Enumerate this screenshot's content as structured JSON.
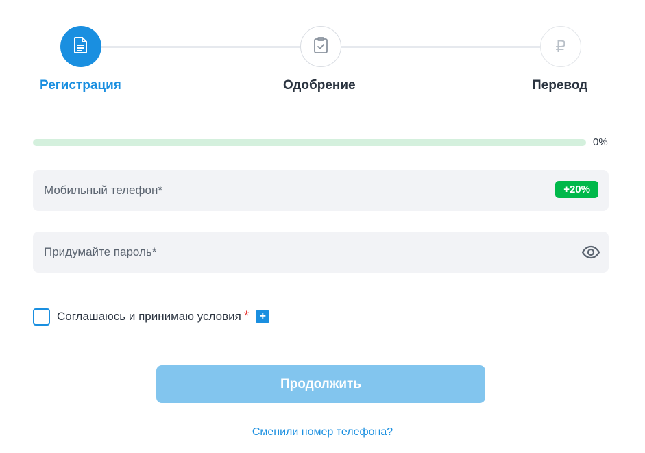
{
  "stepper": {
    "steps": [
      {
        "label": "Регистрация",
        "icon": "document-icon",
        "state": "active"
      },
      {
        "label": "Одобрение",
        "icon": "clipboard-check-icon",
        "state": "pending"
      },
      {
        "label": "Перевод",
        "icon": "ruble-icon",
        "glyph": "₽",
        "state": "pending"
      }
    ]
  },
  "progress": {
    "value": 0,
    "label": "0%"
  },
  "form": {
    "phone": {
      "placeholder": "Мобильный телефон*",
      "value": "",
      "bonus": "+20%"
    },
    "password": {
      "placeholder": "Придумайте пароль*",
      "value": ""
    },
    "agreement": {
      "label": "Соглашаюсь и принимаю условия",
      "required_mark": "*",
      "checked": false,
      "expand": "+"
    }
  },
  "actions": {
    "continue_label": "Продолжить",
    "change_phone_link": "Сменили номер телефона?"
  },
  "colors": {
    "accent": "#1a8fe0",
    "button_disabled": "#82c5ee",
    "bonus_green": "#00b84a",
    "progress_track": "#d4f0dd",
    "field_bg": "#f2f3f6",
    "required": "#e53935"
  }
}
